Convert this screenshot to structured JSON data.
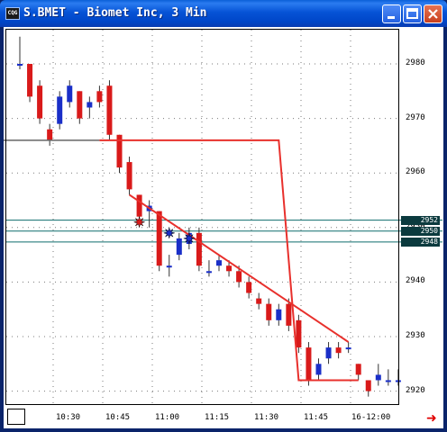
{
  "window": {
    "title": "S.BMET - Biomet Inc, 3 Min",
    "icon": "chart-app-icon",
    "controls": [
      "minimize",
      "maximize",
      "close"
    ]
  },
  "colors": {
    "up_candle": "#1a2fc8",
    "down_candle": "#d91a1a",
    "trendline": "#e8302c",
    "support_line": "#0d6c6c",
    "grid": "#7a7a7a",
    "price_tag_bg": "#0b3a3e"
  },
  "chart_data": {
    "type": "candlestick",
    "title": "S.BMET - Biomet Inc, 3 Min",
    "y_ticks": [
      "2980",
      "2970",
      "2960",
      "2950",
      "2940",
      "2930",
      "2920"
    ],
    "ylim": [
      2916,
      2986
    ],
    "x_ticks": [
      "10:30",
      "10:45",
      "11:00",
      "11:15",
      "11:30",
      "11:45",
      "16-12:00"
    ],
    "price_tags": [
      "2952",
      "2950",
      "2948"
    ],
    "horizontal_levels": [
      2952,
      2950,
      2948
    ],
    "candles": [
      {
        "o": 2980,
        "h": 2985,
        "l": 2979,
        "c": 2980
      },
      {
        "o": 2980,
        "h": 2980,
        "l": 2973,
        "c": 2974
      },
      {
        "o": 2976,
        "h": 2977,
        "l": 2969,
        "c": 2970
      },
      {
        "o": 2968,
        "h": 2969,
        "l": 2965,
        "c": 2966
      },
      {
        "o": 2969,
        "h": 2975,
        "l": 2968,
        "c": 2974
      },
      {
        "o": 2973,
        "h": 2977,
        "l": 2972,
        "c": 2976
      },
      {
        "o": 2975,
        "h": 2975,
        "l": 2969,
        "c": 2970
      },
      {
        "o": 2972,
        "h": 2974,
        "l": 2970,
        "c": 2973
      },
      {
        "o": 2975,
        "h": 2976,
        "l": 2972,
        "c": 2973
      },
      {
        "o": 2976,
        "h": 2977,
        "l": 2966,
        "c": 2967
      },
      {
        "o": 2967,
        "h": 2967,
        "l": 2960,
        "c": 2961
      },
      {
        "o": 2962,
        "h": 2963,
        "l": 2956,
        "c": 2957
      },
      {
        "o": 2956,
        "h": 2956,
        "l": 2951,
        "c": 2952
      },
      {
        "o": 2953,
        "h": 2955,
        "l": 2950,
        "c": 2954
      },
      {
        "o": 2953,
        "h": 2953,
        "l": 2942,
        "c": 2943
      },
      {
        "o": 2943,
        "h": 2945,
        "l": 2941,
        "c": 2943
      },
      {
        "o": 2945,
        "h": 2949,
        "l": 2944,
        "c": 2948
      },
      {
        "o": 2947,
        "h": 2950,
        "l": 2946,
        "c": 2949
      },
      {
        "o": 2949,
        "h": 2950,
        "l": 2942,
        "c": 2943
      },
      {
        "o": 2942,
        "h": 2944,
        "l": 2941,
        "c": 2942
      },
      {
        "o": 2943,
        "h": 2945,
        "l": 2942,
        "c": 2944
      },
      {
        "o": 2943,
        "h": 2944,
        "l": 2941,
        "c": 2942
      },
      {
        "o": 2942,
        "h": 2943,
        "l": 2939,
        "c": 2940
      },
      {
        "o": 2940,
        "h": 2941,
        "l": 2937,
        "c": 2938
      },
      {
        "o": 2937,
        "h": 2938,
        "l": 2935,
        "c": 2936
      },
      {
        "o": 2936,
        "h": 2937,
        "l": 2932,
        "c": 2933
      },
      {
        "o": 2933,
        "h": 2936,
        "l": 2932,
        "c": 2935
      },
      {
        "o": 2936,
        "h": 2937,
        "l": 2931,
        "c": 2932
      },
      {
        "o": 2933,
        "h": 2934,
        "l": 2927,
        "c": 2928
      },
      {
        "o": 2928,
        "h": 2929,
        "l": 2921,
        "c": 2922
      },
      {
        "o": 2923,
        "h": 2926,
        "l": 2922,
        "c": 2925
      },
      {
        "o": 2926,
        "h": 2929,
        "l": 2925,
        "c": 2928
      },
      {
        "o": 2928,
        "h": 2929,
        "l": 2926,
        "c": 2927
      },
      {
        "o": 2928,
        "h": 2929,
        "l": 2927,
        "c": 2928
      },
      {
        "o": 2925,
        "h": 2925,
        "l": 2922,
        "c": 2923
      },
      {
        "o": 2922,
        "h": 2922,
        "l": 2919,
        "c": 2920
      },
      {
        "o": 2922,
        "h": 2925,
        "l": 2921,
        "c": 2923
      },
      {
        "o": 2922,
        "h": 2924,
        "l": 2921,
        "c": 2922
      },
      {
        "o": 2922,
        "h": 2924,
        "l": 2921,
        "c": 2922
      }
    ],
    "trendlines": [
      {
        "from": {
          "i": 11,
          "p": 2956
        },
        "to": {
          "i": 33,
          "p": 2929
        }
      },
      {
        "from": {
          "i": -3,
          "p": 2966
        },
        "to": {
          "i": 8,
          "p": 2966
        }
      },
      {
        "from": {
          "i": 8,
          "p": 2966
        },
        "to": {
          "i": 26,
          "p": 2966
        },
        "then": {
          "i": 28,
          "p": 2922
        },
        "end": {
          "i": 34,
          "p": 2922
        }
      }
    ],
    "markers": [
      {
        "i": 12,
        "p": 2951,
        "color": "red"
      },
      {
        "i": 15,
        "p": 2949,
        "color": "blue"
      },
      {
        "i": 17,
        "p": 2948,
        "color": "blue"
      }
    ]
  }
}
